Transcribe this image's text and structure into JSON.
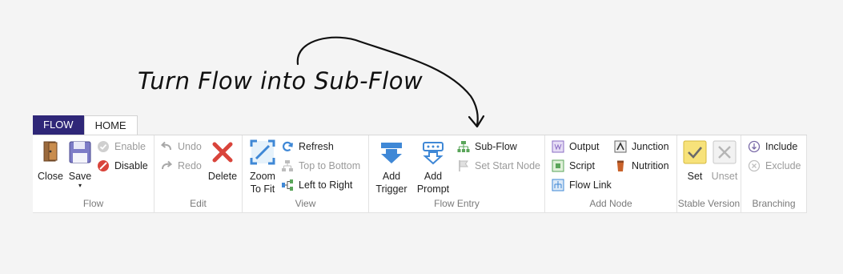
{
  "annotation": "Turn Flow into Sub-Flow",
  "tabs": [
    {
      "label": "FLOW"
    },
    {
      "label": "HOME"
    }
  ],
  "groups": {
    "flow": {
      "label": "Flow",
      "close": "Close",
      "save": "Save",
      "save_caret": "▾",
      "enable": "Enable",
      "disable": "Disable"
    },
    "edit": {
      "label": "Edit",
      "undo": "Undo",
      "redo": "Redo",
      "delete": "Delete"
    },
    "view": {
      "label": "View",
      "zoom_line1": "Zoom",
      "zoom_line2": "To Fit",
      "refresh": "Refresh",
      "top_to_bottom": "Top to Bottom",
      "left_to_right": "Left to Right"
    },
    "flow_entry": {
      "label": "Flow Entry",
      "add_trigger_line1": "Add",
      "add_trigger_line2": "Trigger",
      "add_prompt_line1": "Add",
      "add_prompt_line2": "Prompt",
      "sub_flow": "Sub-Flow",
      "set_start_node": "Set Start Node"
    },
    "add_node": {
      "label": "Add Node",
      "output": "Output",
      "script": "Script",
      "flow_link": "Flow Link",
      "junction": "Junction",
      "nutrition": "Nutrition"
    },
    "stable_version": {
      "label": "Stable Version",
      "set": "Set",
      "unset": "Unset"
    },
    "branching": {
      "label": "Branching",
      "include": "Include",
      "exclude": "Exclude"
    }
  },
  "colors": {
    "flow_tab": "#2f2778",
    "icon_blue": "#3f88d6",
    "icon_red": "#d9443b",
    "stable_yellow": "#f7e27a"
  }
}
